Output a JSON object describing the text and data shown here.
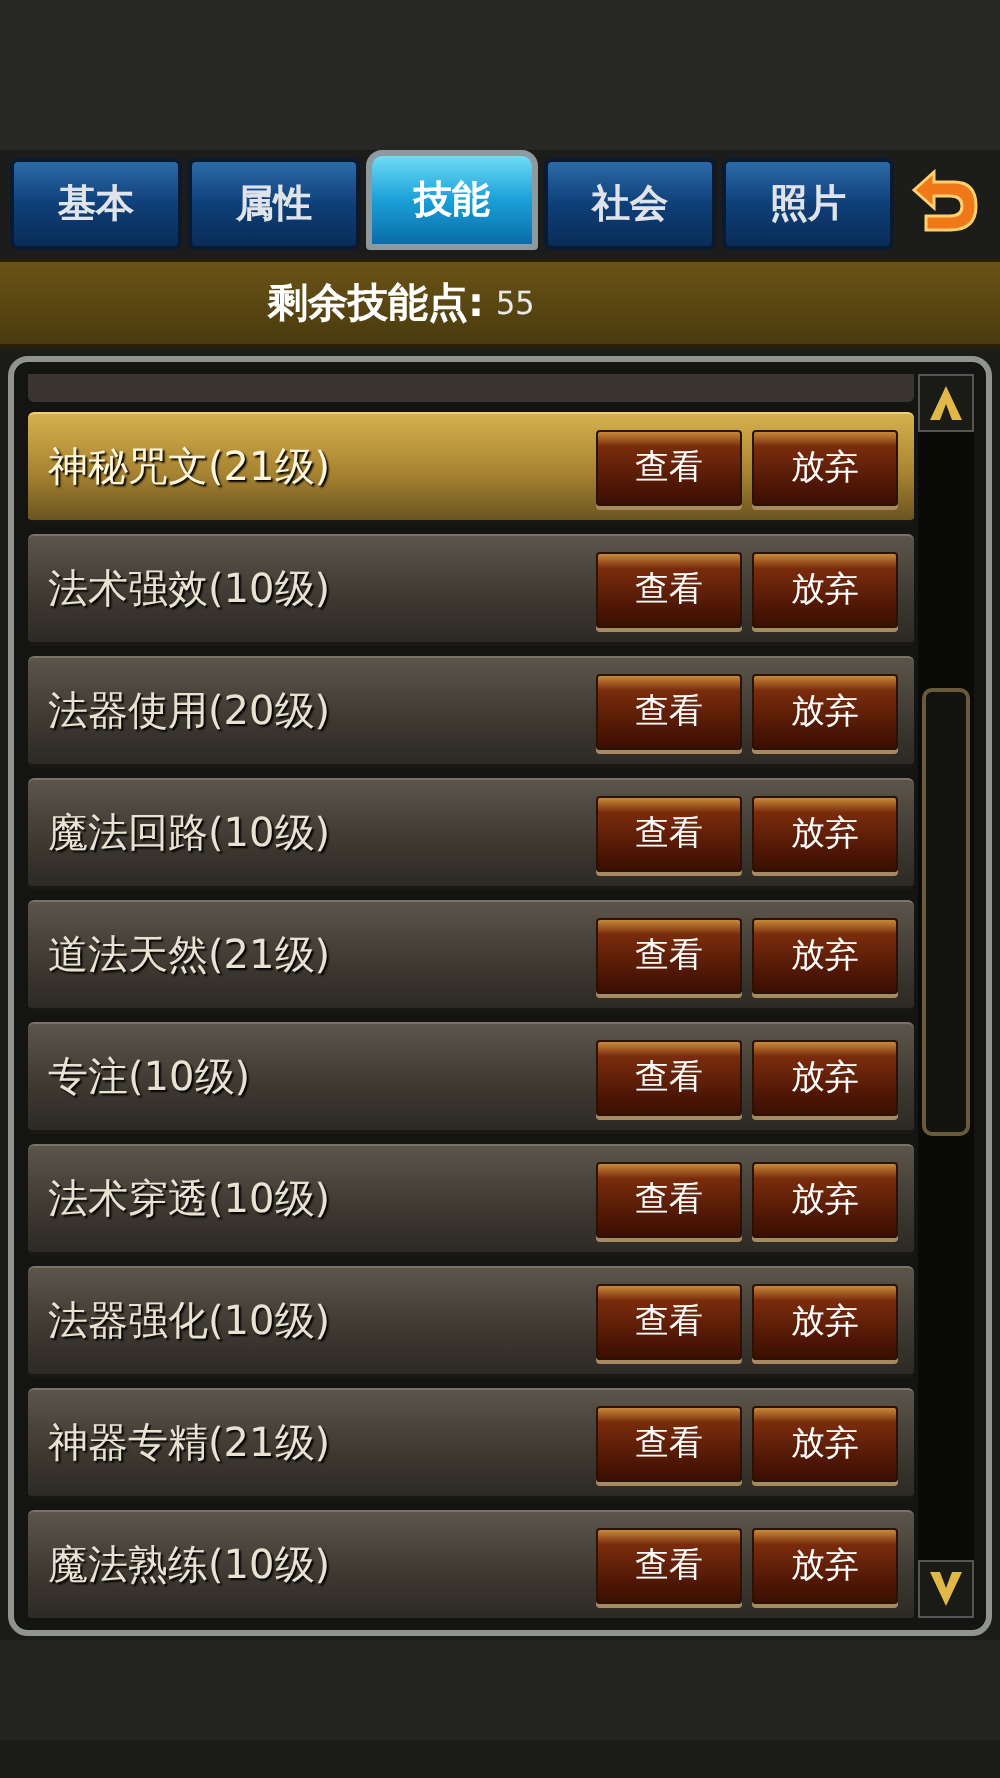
{
  "tabs": [
    {
      "label": "基本",
      "selected": false
    },
    {
      "label": "属性",
      "selected": false
    },
    {
      "label": "技能",
      "selected": true
    },
    {
      "label": "社会",
      "selected": false
    },
    {
      "label": "照片",
      "selected": false
    }
  ],
  "skill_points": {
    "label": "剩余技能点:",
    "value": "55"
  },
  "skills": [
    {
      "name": "神秘咒文(21级)",
      "selected": true,
      "buttons": [
        "查看",
        "放弃"
      ]
    },
    {
      "name": "法术强效(10级)",
      "selected": false,
      "buttons": [
        "查看",
        "放弃"
      ]
    },
    {
      "name": "法器使用(20级)",
      "selected": false,
      "buttons": [
        "查看",
        "放弃"
      ]
    },
    {
      "name": "魔法回路(10级)",
      "selected": false,
      "buttons": [
        "查看",
        "放弃"
      ]
    },
    {
      "name": "道法天然(21级)",
      "selected": false,
      "buttons": [
        "查看",
        "放弃"
      ]
    },
    {
      "name": "专注(10级)",
      "selected": false,
      "buttons": [
        "查看",
        "放弃"
      ]
    },
    {
      "name": "法术穿透(10级)",
      "selected": false,
      "buttons": [
        "查看",
        "放弃"
      ]
    },
    {
      "name": "法器强化(10级)",
      "selected": false,
      "buttons": [
        "查看",
        "放弃"
      ]
    },
    {
      "name": "神器专精(21级)",
      "selected": false,
      "buttons": [
        "查看",
        "放弃"
      ]
    },
    {
      "name": "魔法熟练(10级)",
      "selected": false,
      "buttons": [
        "查看",
        "放弃"
      ]
    }
  ]
}
